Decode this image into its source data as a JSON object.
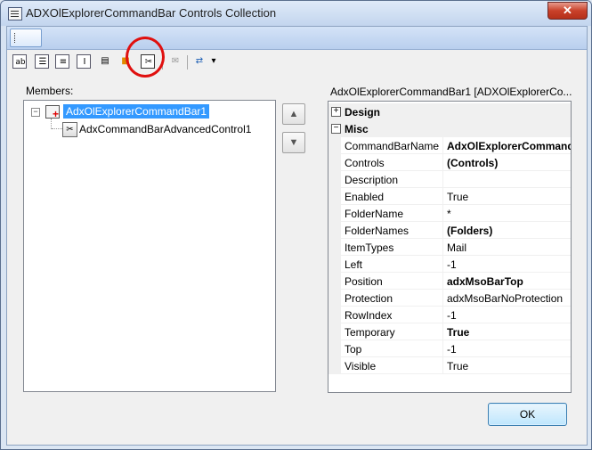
{
  "window": {
    "title": "ADXOlExplorerCommandBar Controls Collection",
    "close_glyph": "✕"
  },
  "toolbar": {
    "icons": [
      "textbox-icon",
      "combobox-icon",
      "dropdown-icon",
      "label-icon",
      "edit-icon",
      "button-icon",
      "advanced-control-icon",
      "disabled-icon",
      "popup-icon"
    ]
  },
  "members": {
    "label": "Members:",
    "root": "AdxOlExplorerCommandBar1",
    "child": "AdxCommandBarAdvancedControl1"
  },
  "properties": {
    "header": "AdxOlExplorerCommandBar1 [ADXOlExplorerCo...",
    "categories": [
      {
        "name": "Design",
        "toggle": "+"
      },
      {
        "name": "Misc",
        "toggle": "−"
      }
    ],
    "rows": [
      {
        "name": "CommandBarName",
        "value": "AdxOlExplorerCommand",
        "bold": true
      },
      {
        "name": "Controls",
        "value": "(Controls)",
        "bold": true
      },
      {
        "name": "Description",
        "value": "",
        "bold": false
      },
      {
        "name": "Enabled",
        "value": "True",
        "bold": false
      },
      {
        "name": "FolderName",
        "value": "*",
        "bold": false
      },
      {
        "name": "FolderNames",
        "value": "(Folders)",
        "bold": true
      },
      {
        "name": "ItemTypes",
        "value": "Mail",
        "bold": false
      },
      {
        "name": "Left",
        "value": "-1",
        "bold": false
      },
      {
        "name": "Position",
        "value": "adxMsoBarTop",
        "bold": true
      },
      {
        "name": "Protection",
        "value": "adxMsoBarNoProtection",
        "bold": false
      },
      {
        "name": "RowIndex",
        "value": "-1",
        "bold": false
      },
      {
        "name": "Temporary",
        "value": "True",
        "bold": true
      },
      {
        "name": "Top",
        "value": "-1",
        "bold": false
      },
      {
        "name": "Visible",
        "value": "True",
        "bold": false
      }
    ]
  },
  "buttons": {
    "ok": "OK",
    "up_glyph": "▲",
    "down_glyph": "▼",
    "dropdown_glyph": "▾"
  }
}
